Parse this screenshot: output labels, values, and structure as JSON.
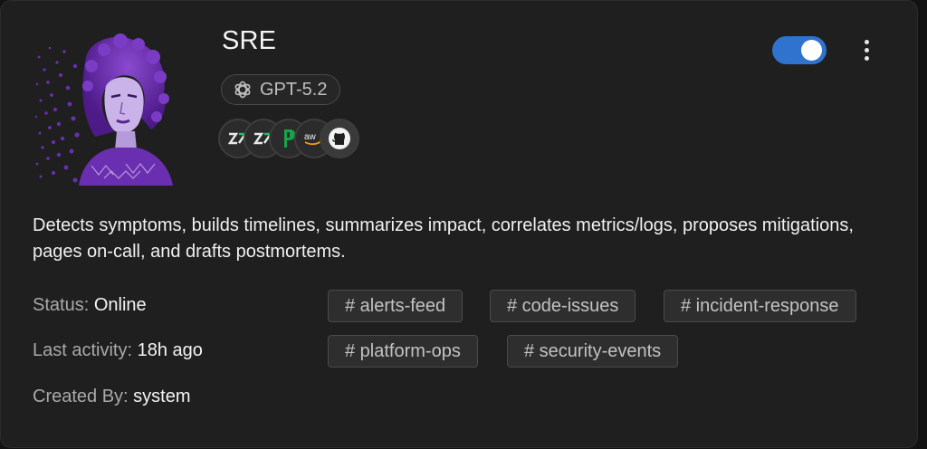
{
  "agent": {
    "name": "SRE",
    "enabled": true,
    "model": {
      "label": "GPT-5.2",
      "icon": "openai-icon"
    },
    "integrations": [
      {
        "name": "zapier-icon"
      },
      {
        "name": "zapier-icon"
      },
      {
        "name": "pagerduty-icon"
      },
      {
        "name": "aws-icon",
        "text": "aw"
      },
      {
        "name": "github-icon"
      }
    ],
    "description": "Detects symptoms, builds timelines, summarizes impact, correlates metrics/logs, proposes mitigations, pages on-call, and drafts postmortems.",
    "meta": {
      "status_label": "Status:",
      "status_value": "Online",
      "activity_label": "Last activity:",
      "activity_value": "18h ago",
      "created_label": "Created By:",
      "created_value": "system"
    },
    "tags": [
      "# alerts-feed",
      "# code-issues",
      "# incident-response",
      "# platform-ops",
      "# security-events"
    ]
  },
  "colors": {
    "accent": "#2f73cf",
    "avatar": "#6a2fb0"
  }
}
